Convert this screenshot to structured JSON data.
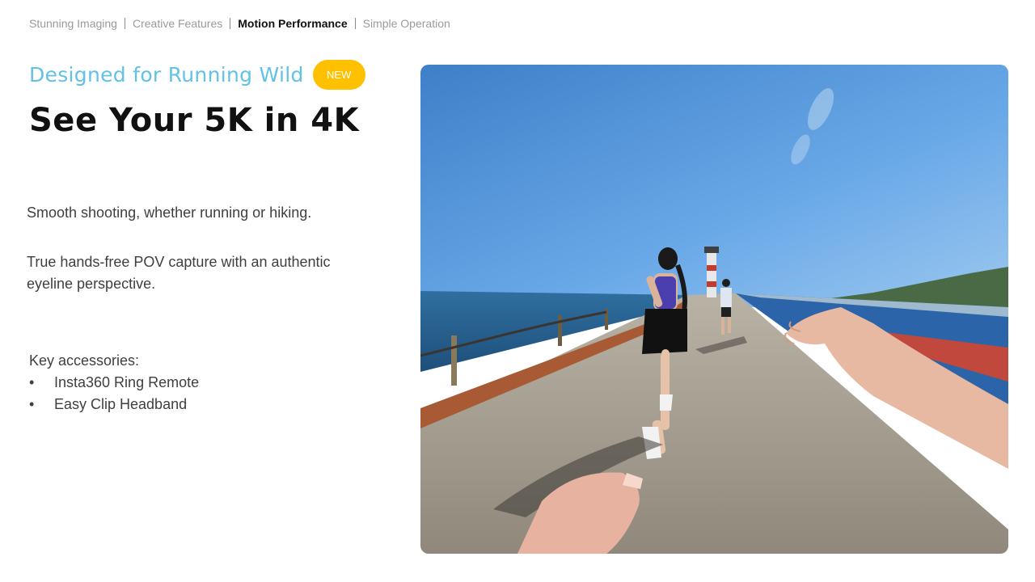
{
  "nav": {
    "tabs": [
      {
        "label": "Stunning Imaging",
        "active": false
      },
      {
        "label": "Creative Features",
        "active": false
      },
      {
        "label": "Motion Performance",
        "active": true
      },
      {
        "label": "Simple Operation",
        "active": false
      }
    ]
  },
  "hero": {
    "eyebrow": "Designed for Running Wild",
    "badge": "NEW",
    "title": "See Your 5K in 4K"
  },
  "body": {
    "desc1": "Smooth shooting, whether running or hiking.",
    "desc2": "True hands-free POV capture with an authentic eyeline perspective."
  },
  "accessories": {
    "heading": "Key accessories:",
    "bullet": "•",
    "items": [
      "Insta360 Ring Remote",
      "Easy Clip Headband"
    ]
  },
  "colors": {
    "accent": "#62c2e6",
    "badge": "#ffc000",
    "active_tab": "#111111",
    "inactive_tab": "#9a9a9a"
  }
}
